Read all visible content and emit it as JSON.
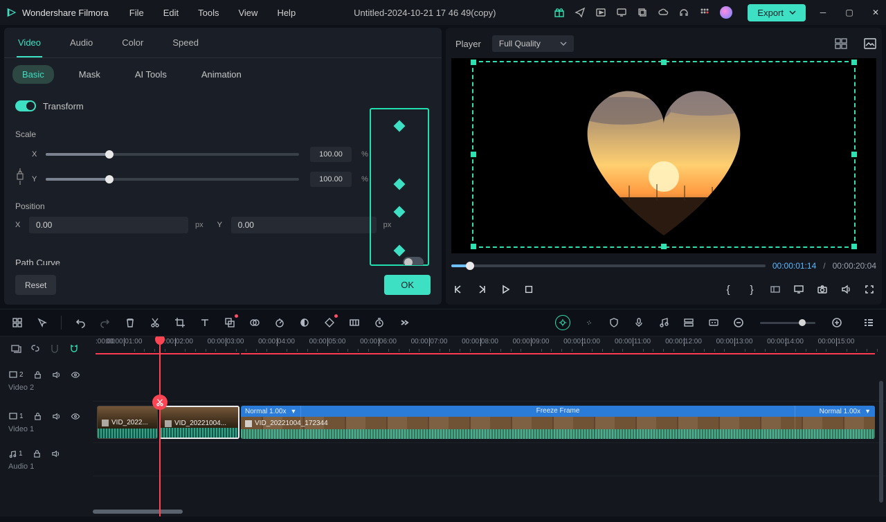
{
  "app": {
    "name": "Wondershare Filmora",
    "document_title": "Untitled-2024-10-21 17 46 49(copy)"
  },
  "menu": [
    "File",
    "Edit",
    "Tools",
    "View",
    "Help"
  ],
  "title_icons": [
    "gift-icon",
    "send-icon",
    "media-icon",
    "screen-icon",
    "layers-icon",
    "cloud-icon",
    "headset-icon",
    "apps-icon"
  ],
  "export_label": "Export",
  "tabs": {
    "items": [
      "Video",
      "Audio",
      "Color",
      "Speed"
    ],
    "active": "Video"
  },
  "subtabs": {
    "items": [
      "Basic",
      "Mask",
      "AI Tools",
      "Animation"
    ],
    "active": "Basic"
  },
  "transform": {
    "label": "Transform",
    "scale_label": "Scale",
    "x": {
      "label": "X",
      "value": "100.00",
      "unit": "%"
    },
    "y": {
      "label": "Y",
      "value": "100.00",
      "unit": "%"
    },
    "position_label": "Position",
    "pos_x": {
      "label": "X",
      "value": "0.00",
      "unit": "px"
    },
    "pos_y": {
      "label": "Y",
      "value": "0.00",
      "unit": "px"
    },
    "path_curve_label": "Path Curve"
  },
  "buttons": {
    "reset": "Reset",
    "ok": "OK"
  },
  "player": {
    "label": "Player",
    "quality": "Full Quality",
    "current_time": "00:00:01:14",
    "total_time": "00:00:20:04"
  },
  "ruler_start": ":00:00",
  "ruler_labels": [
    "00:00:01:00",
    "00:00:02:00",
    "00:00:03:00",
    "00:00:04:00",
    "00:00:05:00",
    "00:00:06:00",
    "00:00:07:00",
    "00:00:08:00",
    "00:00:09:00",
    "00:00:10:00",
    "00:00:11:00",
    "00:00:12:00",
    "00:00:13:00",
    "00:00:14:00",
    "00:00:15:00"
  ],
  "tracks": {
    "video2": {
      "icon_label": "2",
      "name": "Video 2"
    },
    "video1": {
      "icon_label": "1",
      "name": "Video 1"
    },
    "audio1": {
      "icon_label": "1",
      "name": "Audio 1"
    }
  },
  "clips": {
    "a": {
      "label": "VID_2022..."
    },
    "b": {
      "label": "VID_20221004..."
    },
    "c": {
      "file": "VID_20221004_172344",
      "left_tag": "Normal 1.00x",
      "center_tag": "Freeze Frame",
      "right_tag": "Normal 1.00x"
    }
  }
}
